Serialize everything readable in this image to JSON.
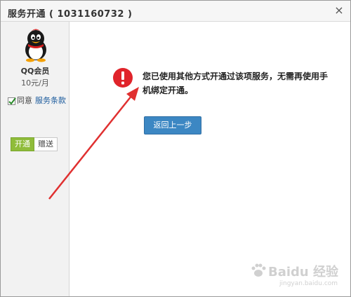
{
  "dialog": {
    "title": "服务开通 ( 1031160732 )",
    "close_icon": "close-icon"
  },
  "sidebar": {
    "avatar_icon": "qq-penguin-icon",
    "product_name": "QQ会员",
    "product_price": "10元/月",
    "agree_checked": true,
    "agree_label": "同意",
    "terms_link": "服务条款",
    "tabs": [
      {
        "label": "开通",
        "active": true
      },
      {
        "label": "赠送",
        "active": false
      }
    ]
  },
  "content": {
    "alert_icon": "exclamation-icon",
    "message": "您已使用其他方式开通过该项服务，无需再使用手机绑定开通。",
    "back_button_label": "返回上一步"
  },
  "watermark": {
    "text": "Baidu 经验",
    "url": "jingyan.baidu.com"
  },
  "colors": {
    "accent_green": "#8fbc3a",
    "button_blue": "#3c87c3",
    "alert_red": "#e0242b",
    "arrow_red": "#e03030",
    "link_blue": "#1a5a9c"
  }
}
